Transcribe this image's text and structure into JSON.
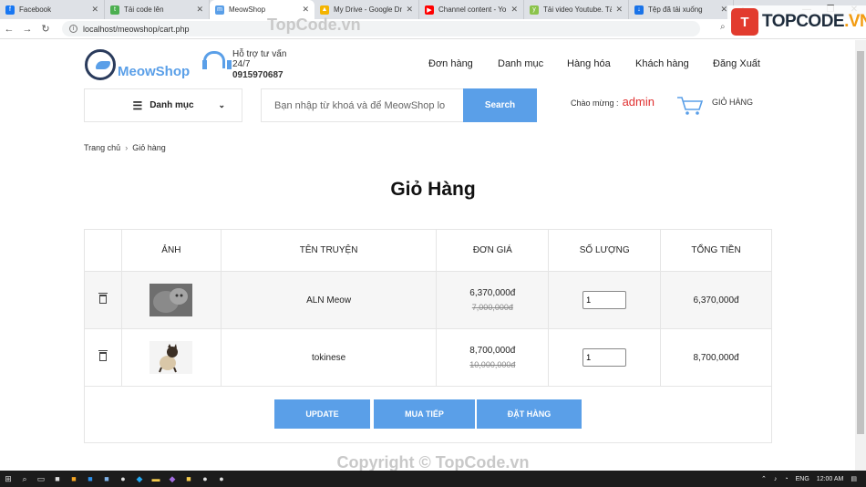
{
  "browser": {
    "tabs": [
      {
        "label": "Facebook",
        "color": "#1877f2",
        "glyph": "f"
      },
      {
        "label": "Tải code lên",
        "color": "#4caf50",
        "glyph": "t"
      },
      {
        "label": "MeowShop",
        "color": "#5a9fe8",
        "glyph": "m"
      },
      {
        "label": "My Drive - Google Dr",
        "color": "#f4b400",
        "glyph": "▲"
      },
      {
        "label": "Channel content - Yo",
        "color": "#ff0000",
        "glyph": "▶"
      },
      {
        "label": "Tải video Youtube. Tả",
        "color": "#8bc34a",
        "glyph": "y"
      },
      {
        "label": "Tệp đã tải xuống",
        "color": "#1a73e8",
        "glyph": "↓"
      }
    ],
    "url": "localhost/meowshop/cart.php"
  },
  "watermark": {
    "logo_mark": "T",
    "logo_text_a": "TOPCODE",
    "logo_text_b": ".VN",
    "top_text": "TopCode.vn",
    "bottom_text": "Copyright © TopCode.vn"
  },
  "header": {
    "logo_text": "MeowShop",
    "support_line1": "Hỗ trợ tư vấn",
    "support_line2": "24/7",
    "support_phone": "0915970687",
    "nav": [
      "Đơn hàng",
      "Danh mục",
      "Hàng hóa",
      "Khách hàng",
      "Đăng Xuất"
    ],
    "category_label": "Danh mục",
    "search_placeholder": "Bạn nhập từ khoá và để MeowShop lo",
    "search_button": "Search",
    "welcome_label": "Chào mừng :",
    "username": "admin",
    "cart_label": "GIỎ HÀNG"
  },
  "breadcrumb": {
    "home": "Trang chủ",
    "current": "Giỏ hàng"
  },
  "page_title": "Giỏ Hàng",
  "cart": {
    "headers": [
      "",
      "ẢNH",
      "TÊN TRUYỆN",
      "ĐƠN GIÁ",
      "SỐ LƯỢNG",
      "TỔNG TIỀN"
    ],
    "rows": [
      {
        "name": "ALN Meow",
        "price": "6,370,000đ",
        "old_price": "7,000,000đ",
        "qty": "1",
        "total": "6,370,000đ"
      },
      {
        "name": "tokinese",
        "price": "8,700,000đ",
        "old_price": "10,000,000đ",
        "qty": "1",
        "total": "8,700,000đ"
      }
    ],
    "buttons": {
      "update": "UPDATE",
      "continue": "MUA TIẾP",
      "order": "ĐẶT HÀNG"
    }
  },
  "taskbar": {
    "lang": "ENG",
    "time": "12:00 AM"
  },
  "colors": {
    "accent": "#5a9fe8",
    "username": "#e03030"
  }
}
